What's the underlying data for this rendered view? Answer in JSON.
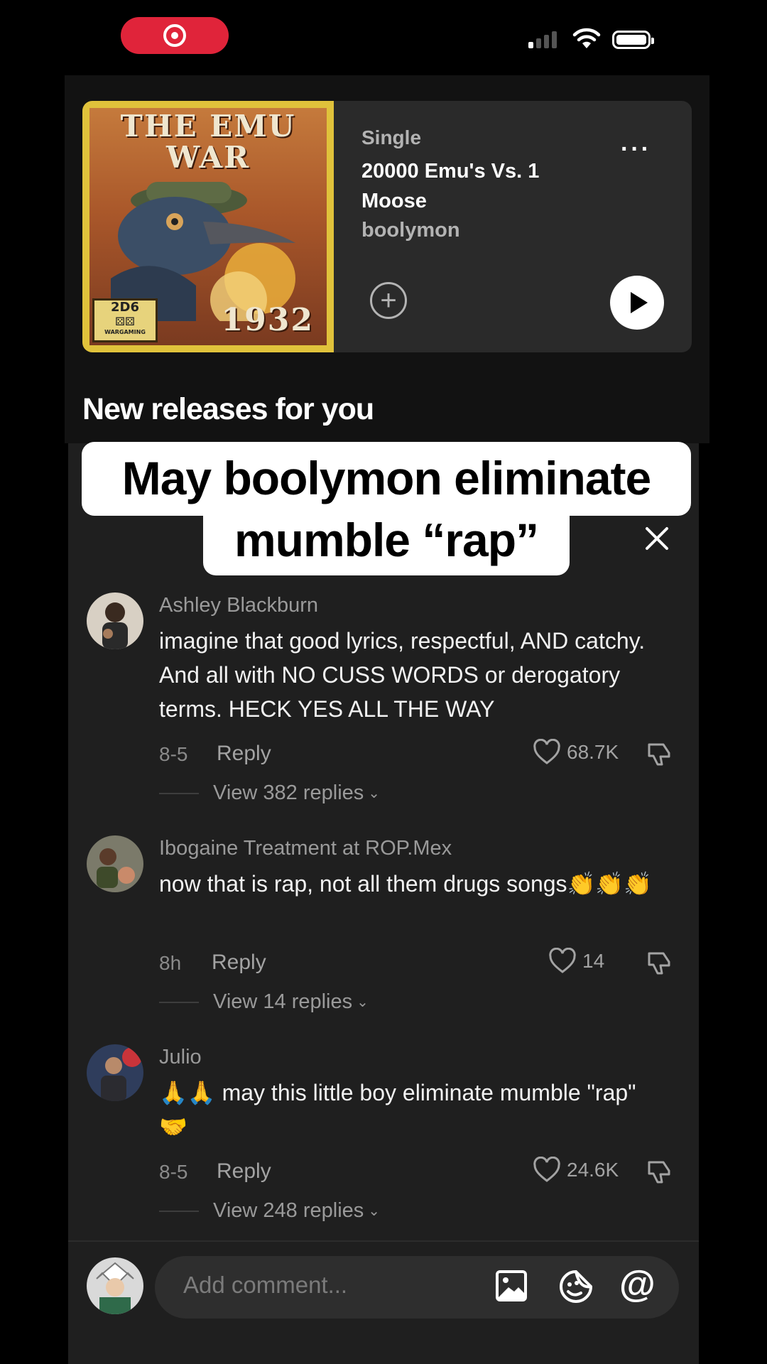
{
  "status_bar": {
    "recording_icon": "screen-record-icon",
    "signal_icon": "signal-bars-icon",
    "wifi_icon": "wifi-icon",
    "battery_icon": "battery-icon"
  },
  "spotify": {
    "cover": {
      "title": "THE EMU WAR",
      "year": "1932",
      "badge_number": "2D6",
      "badge_sub": "WARGAMING"
    },
    "release_type": "Single",
    "track_title": "20000 Emu's Vs. 1 Moose",
    "artist": "boolymon",
    "more_icon": "more-dots-icon",
    "add_icon": "add-circle-icon",
    "play_icon": "play-icon",
    "section_title": "New releases for you"
  },
  "caption": {
    "line1": "May boolymon eliminate",
    "line2": "mumble “rap”"
  },
  "comments": [
    {
      "user": "Ashley Blackburn",
      "text": "imagine that good lyrics, respectful, AND catchy. And all with NO CUSS WORDS or derogatory terms. HECK YES ALL THE WAY",
      "date": "8-5",
      "reply_label": "Reply",
      "likes": "68.7K",
      "view_replies": "View 382 replies"
    },
    {
      "user": "Ibogaine Treatment at ROP.Mex",
      "text": "now that is rap, not all them drugs songs👏👏👏",
      "date": "8h",
      "reply_label": "Reply",
      "likes": "14",
      "view_replies": "View 14 replies"
    },
    {
      "user": "Julio",
      "text": "🙏🙏 may this little boy eliminate mumble \"rap\" 🤝",
      "date": "8-5",
      "reply_label": "Reply",
      "likes": "24.6K",
      "view_replies": "View 248 replies"
    }
  ],
  "comment_input": {
    "placeholder": "Add comment...",
    "image_icon": "image-icon",
    "emoji_icon": "emoji-icon",
    "mention_icon": "at-mention-icon"
  },
  "colors": {
    "record_red": "#e0243a",
    "sheet_bg": "#1f1f1f",
    "spotify_card": "#2a2a2a"
  }
}
